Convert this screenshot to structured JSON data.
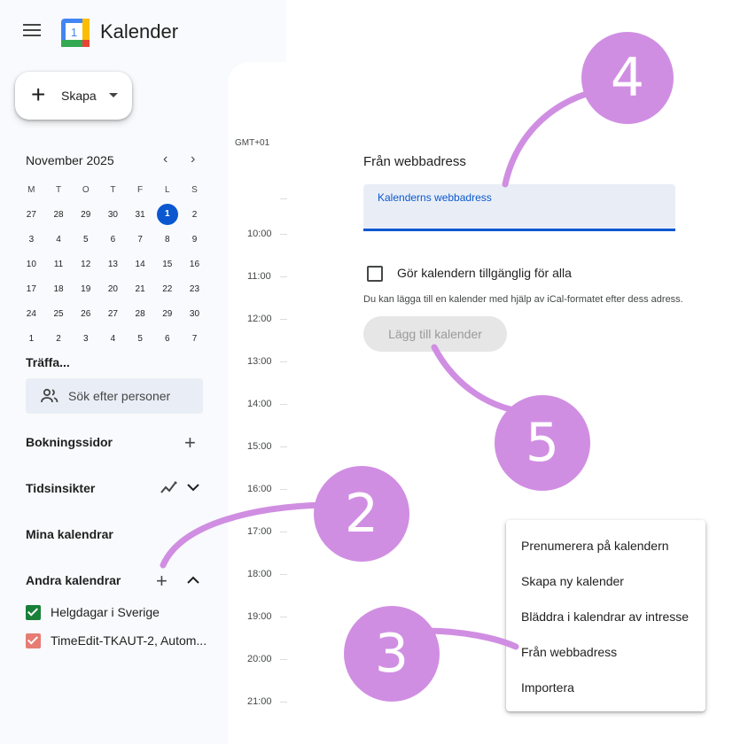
{
  "header": {
    "app_title": "Kalender"
  },
  "create": {
    "label": "Skapa"
  },
  "mini_calendar": {
    "month": "November 2025",
    "weekdays": [
      "M",
      "T",
      "O",
      "T",
      "F",
      "L",
      "S"
    ],
    "weeks": [
      [
        "27",
        "28",
        "29",
        "30",
        "31",
        "1",
        "2"
      ],
      [
        "3",
        "4",
        "5",
        "6",
        "7",
        "8",
        "9"
      ],
      [
        "10",
        "11",
        "12",
        "13",
        "14",
        "15",
        "16"
      ],
      [
        "17",
        "18",
        "19",
        "20",
        "21",
        "22",
        "23"
      ],
      [
        "24",
        "25",
        "26",
        "27",
        "28",
        "29",
        "30"
      ],
      [
        "1",
        "2",
        "3",
        "4",
        "5",
        "6",
        "7"
      ]
    ]
  },
  "sidebar": {
    "meet_title": "Träffa...",
    "search_people": "Sök efter personer",
    "booking_pages": "Bokningssidor",
    "time_insights": "Tidsinsikter",
    "my_calendars": "Mina kalendrar",
    "other_calendars": "Andra kalendrar",
    "calendars": [
      {
        "label": "Helgdagar i Sverige",
        "color": "#188038"
      },
      {
        "label": "TimeEdit-TKAUT-2, Autom...",
        "color": "#e67c73"
      }
    ]
  },
  "grid": {
    "timezone": "GMT+01",
    "times": [
      "10:00",
      "11:00",
      "12:00",
      "13:00",
      "14:00",
      "15:00",
      "16:00",
      "17:00",
      "18:00",
      "19:00",
      "20:00",
      "21:00"
    ]
  },
  "form": {
    "title": "Från webbadress",
    "url_label": "Kalenderns webbadress",
    "public_checkbox": "Gör kalendern tillgänglig för alla",
    "help_text": "Du kan lägga till en kalender med hjälp av iCal-formatet efter dess adress.",
    "add_button": "Lägg till kalender"
  },
  "menu": {
    "items": [
      "Prenumerera på kalendern",
      "Skapa ny kalender",
      "Bläddra i kalendrar av intresse",
      "Från webbadress",
      "Importera"
    ]
  },
  "annotations": {
    "steps": [
      "2",
      "3",
      "4",
      "5"
    ],
    "color": "#d08ee2"
  },
  "colors": {
    "accent": "#0b57d0"
  }
}
